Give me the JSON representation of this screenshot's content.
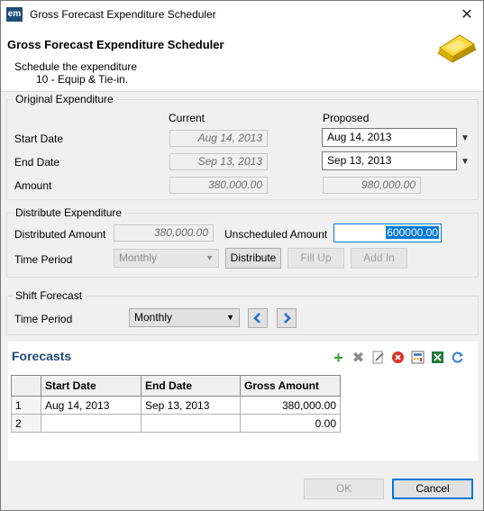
{
  "window": {
    "title": "Gross Forecast Expenditure Scheduler",
    "app_icon": "em",
    "close_glyph": "✕"
  },
  "header": {
    "title": "Gross Forecast Expenditure Scheduler",
    "line1": "Schedule the expenditure",
    "line2": "10 - Equip & Tie-in."
  },
  "original": {
    "legend": "Original Expenditure",
    "col_current": "Current",
    "col_proposed": "Proposed",
    "start_label": "Start Date",
    "end_label": "End Date",
    "amount_label": "Amount",
    "start_current": "Aug 14, 2013",
    "end_current": "Sep 13, 2013",
    "amount_current": "380,000.00",
    "start_proposed": "Aug 14, 2013",
    "end_proposed": "Sep 13, 2013",
    "amount_proposed": "980,000.00"
  },
  "distribute": {
    "legend": "Distribute Expenditure",
    "distributed_label": "Distributed Amount",
    "distributed_value": "380,000.00",
    "unscheduled_label": "Unscheduled Amount",
    "unscheduled_value": "600000.00",
    "period_label": "Time Period",
    "period_value": "Monthly",
    "distribute_btn": "Distribute",
    "fillup_btn": "Fill Up",
    "addin_btn": "Add In"
  },
  "shift": {
    "legend": "Shift Forecast",
    "period_label": "Time Period",
    "period_value": "Monthly"
  },
  "forecasts": {
    "title": "Forecasts",
    "columns": [
      "Start Date",
      "End Date",
      "Gross Amount"
    ],
    "rows": [
      {
        "n": "1",
        "start": "Aug 14, 2013",
        "end": "Sep 13, 2013",
        "amount": "380,000.00"
      },
      {
        "n": "2",
        "start": "",
        "end": "",
        "amount": "0.00"
      }
    ],
    "toolbar_icons": [
      "add-icon",
      "delete-icon",
      "edit-icon",
      "remove-icon",
      "calculator-icon",
      "excel-icon",
      "refresh-icon"
    ]
  },
  "footer": {
    "ok": "OK",
    "cancel": "Cancel"
  },
  "colors": {
    "accent": "#0078d7",
    "forecast_title": "#1f497d",
    "add_green": "#3aa430",
    "delete_gray": "#8a8a8a",
    "remove_red": "#d93025"
  }
}
